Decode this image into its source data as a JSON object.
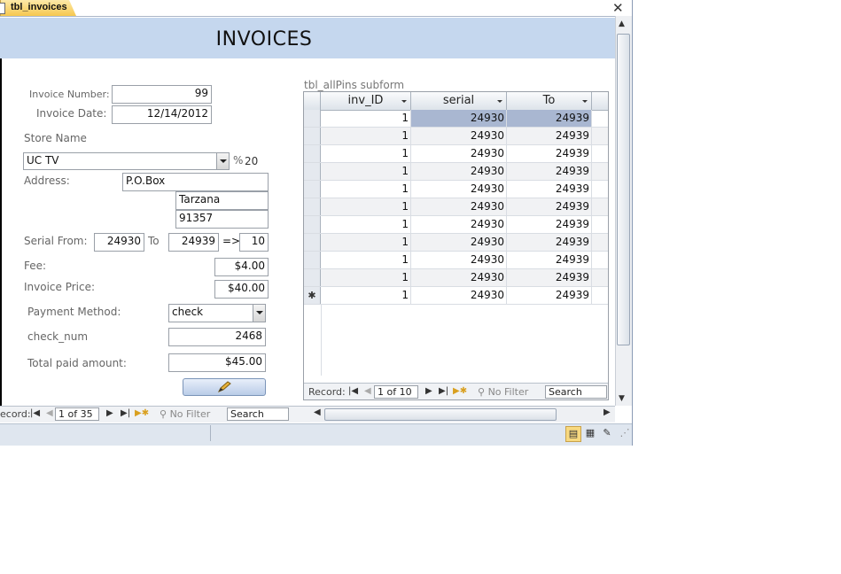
{
  "document_tab": {
    "label": "tbl_invoices"
  },
  "window": {
    "close_glyph": "✕"
  },
  "form": {
    "title": "INVOICES",
    "invoice_number": {
      "label": "Invoice Number:",
      "value": "99"
    },
    "invoice_date": {
      "label": "Invoice Date:",
      "value": "12/14/2012"
    },
    "store_name": {
      "label": "Store Name",
      "value": "UC TV",
      "percent_symbol": "%",
      "percent_value": "20"
    },
    "address": {
      "label": "Address:",
      "line1": "P.O.Box",
      "line2": "Tarzana",
      "line3": "91357"
    },
    "serial": {
      "from_label": "Serial From:",
      "from_value": "24930",
      "to_label": "To",
      "to_value": "24939",
      "arrow": "=>",
      "count": "10"
    },
    "fee": {
      "label": "Fee:",
      "value": "$4.00"
    },
    "invoice_price": {
      "label": "Invoice Price:",
      "value": "$40.00"
    },
    "payment_method": {
      "label": "Payment Method:",
      "value": "check"
    },
    "check_num": {
      "label": "check_num",
      "value": "2468"
    },
    "total_paid": {
      "label": "Total paid amount:",
      "value": "$45.00"
    },
    "edit_button_icon": "pencil-icon"
  },
  "subform": {
    "label": "tbl_allPins subform",
    "columns": [
      "inv_ID",
      "serial",
      "To"
    ],
    "rows": [
      [
        "1",
        "24930",
        "24939"
      ],
      [
        "1",
        "24930",
        "24939"
      ],
      [
        "1",
        "24930",
        "24939"
      ],
      [
        "1",
        "24930",
        "24939"
      ],
      [
        "1",
        "24930",
        "24939"
      ],
      [
        "1",
        "24930",
        "24939"
      ],
      [
        "1",
        "24930",
        "24939"
      ],
      [
        "1",
        "24930",
        "24939"
      ],
      [
        "1",
        "24930",
        "24939"
      ],
      [
        "1",
        "24930",
        "24939"
      ]
    ],
    "new_row": {
      "marker": "✱",
      "values": [
        "1",
        "24930",
        "24939"
      ]
    },
    "nav": {
      "record_label": "Record:",
      "position": "1 of 10",
      "filter": "No Filter",
      "search": "Search"
    }
  },
  "main_nav": {
    "record_label": "ecord:",
    "position": "1 of 35",
    "filter": "No Filter",
    "search": "Search"
  },
  "colors": {
    "header_band": "#c5d7ee",
    "selected_cell": "#a9b7d1",
    "active_tab": "#f6c850"
  }
}
